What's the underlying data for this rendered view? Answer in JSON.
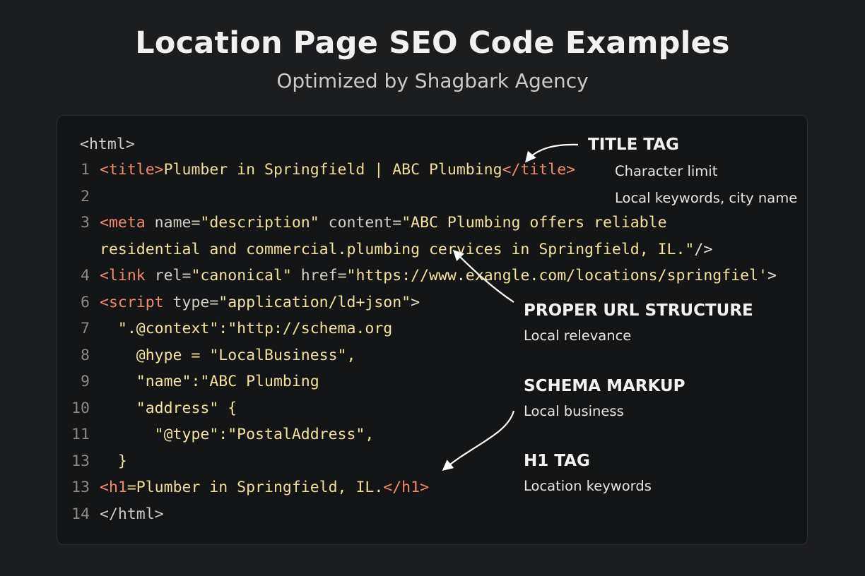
{
  "header": {
    "title": "Location Page SEO Code Examples",
    "subtitle": "Optimized by Shagbark Agency"
  },
  "code": {
    "open_html": "<html>",
    "lines": [
      {
        "num": "1",
        "segments": [
          {
            "cls": "c-tag",
            "text": "<title>"
          },
          {
            "cls": "c-txt",
            "text": "Plumber in Springfield | ABC Plumbing"
          },
          {
            "cls": "c-tag",
            "text": "</title>"
          }
        ]
      },
      {
        "num": "2",
        "segments": []
      },
      {
        "num": "3",
        "segments": [
          {
            "cls": "c-tag",
            "text": "<meta"
          },
          {
            "cls": "c-attr",
            "text": " name="
          },
          {
            "cls": "c-str",
            "text": "\"description\""
          },
          {
            "cls": "c-attr",
            "text": " content="
          },
          {
            "cls": "c-str",
            "text": "\"ABC Plumbing offers reliable"
          }
        ]
      },
      {
        "num": "",
        "segments": [
          {
            "cls": "c-str",
            "text": "residential and commercial.plumbing cervices in Springfield, IL.\""
          },
          {
            "cls": "c-punct",
            "text": "/>"
          }
        ]
      },
      {
        "num": "4",
        "segments": [
          {
            "cls": "c-tag",
            "text": "<link"
          },
          {
            "cls": "c-attr",
            "text": " rel="
          },
          {
            "cls": "c-str",
            "text": "\"canonical\""
          },
          {
            "cls": "c-attr",
            "text": " href="
          },
          {
            "cls": "c-str",
            "text": "\"https://www.exangle.com/locations/springfiel'"
          },
          {
            "cls": "c-punct",
            "text": ">"
          }
        ]
      },
      {
        "num": "6",
        "segments": [
          {
            "cls": "c-tag",
            "text": "<script"
          },
          {
            "cls": "c-attr",
            "text": " type="
          },
          {
            "cls": "c-str",
            "text": "\"application/ld+json\""
          },
          {
            "cls": "c-punct",
            "text": ">"
          }
        ]
      },
      {
        "num": "7",
        "segments": [
          {
            "cls": "c-str",
            "text": "  \".@context\":\"http://schema.org"
          }
        ]
      },
      {
        "num": "8",
        "segments": [
          {
            "cls": "c-str",
            "text": "    @hype = \"LocalBusiness\","
          }
        ]
      },
      {
        "num": "9",
        "segments": [
          {
            "cls": "c-str",
            "text": "    \"name\":\"ABC Plumbing"
          }
        ]
      },
      {
        "num": "10",
        "segments": [
          {
            "cls": "c-str",
            "text": "    \"address\" {"
          }
        ]
      },
      {
        "num": "11",
        "segments": [
          {
            "cls": "c-str",
            "text": "      \"@type\":\"PostalAddress\","
          }
        ]
      },
      {
        "num": "13",
        "segments": [
          {
            "cls": "c-str",
            "text": "  }"
          }
        ]
      },
      {
        "num": "13",
        "segments": [
          {
            "cls": "c-tag",
            "text": "<h1"
          },
          {
            "cls": "c-txt",
            "text": "=Plumber in Springfield, IL."
          },
          {
            "cls": "c-tag",
            "text": "</h1>"
          }
        ]
      },
      {
        "num": "14",
        "segments": [
          {
            "cls": "c-html",
            "text": "</html>"
          }
        ]
      }
    ]
  },
  "annotations": {
    "title_tag": {
      "heading": "TITLE TAG",
      "lines": [
        "Character limit",
        "Local keywords, city name"
      ]
    },
    "url": {
      "heading": "PROPER URL STRUCTURE",
      "lines": [
        "Local relevance"
      ]
    },
    "schema": {
      "heading": "SCHEMA MARKUP",
      "lines": [
        "Local business"
      ]
    },
    "h1": {
      "heading": "H1 TAG",
      "lines": [
        "Location keywords"
      ]
    }
  },
  "colors": {
    "background": "#1c1d1f",
    "panel": "#141517",
    "tag": "#ef8c6c",
    "string": "#f5e29a",
    "line_number": "#8a8a86"
  }
}
